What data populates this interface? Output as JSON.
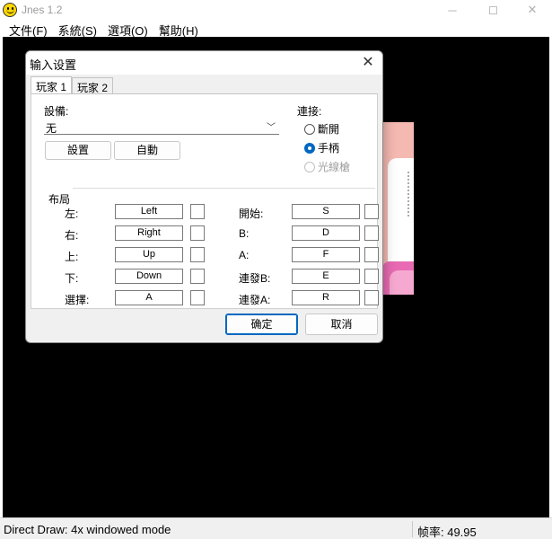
{
  "window": {
    "title": "Jnes 1.2",
    "controls": {
      "minimize": "─",
      "maximize": "",
      "close": "✕"
    }
  },
  "menu": [
    "文件(F)",
    "系統(S)",
    "選項(O)",
    "幫助(H)"
  ],
  "status": {
    "mode": "Direct Draw: 4x windowed mode",
    "fps": "帧率: 49.95"
  },
  "dialog": {
    "title": "输入设置",
    "close": "✕",
    "tabs": [
      "玩家 1",
      "玩家 2"
    ],
    "device_label": "設備:",
    "device_value": "无",
    "buttons": {
      "setup": "設置",
      "auto": "自動"
    },
    "connect_label": "連接:",
    "radios": [
      {
        "label": "斷開",
        "checked": false,
        "disabled": false
      },
      {
        "label": "手柄",
        "checked": true,
        "disabled": false
      },
      {
        "label": "光線槍",
        "checked": false,
        "disabled": true
      }
    ],
    "layout_label": "布局",
    "left_keys": [
      {
        "label": "左:",
        "key": "Left"
      },
      {
        "label": "右:",
        "key": "Right"
      },
      {
        "label": "上:",
        "key": "Up"
      },
      {
        "label": "下:",
        "key": "Down"
      },
      {
        "label": "選擇:",
        "key": "A"
      }
    ],
    "right_keys": [
      {
        "label": "開始:",
        "key": "S"
      },
      {
        "label": "B:",
        "key": "D"
      },
      {
        "label": "A:",
        "key": "F"
      },
      {
        "label": "連發B:",
        "key": "E"
      },
      {
        "label": "連發A:",
        "key": "R"
      }
    ],
    "ok": "确定",
    "cancel": "取消"
  },
  "colors": {
    "accent": "#0067c0",
    "screen": "#000000",
    "dialog_bg": "#f0f0f0"
  }
}
